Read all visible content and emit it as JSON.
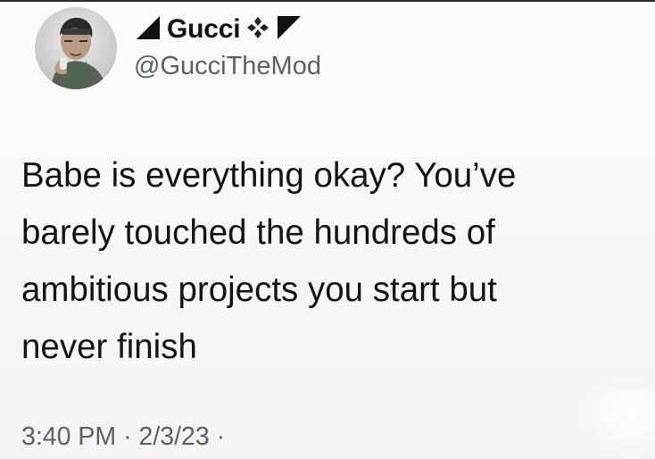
{
  "tweet": {
    "display_name": "Gucci",
    "handle": "@GucciTheMod",
    "text_lines": [
      "Babe is everything okay? You’ve",
      "barely touched the hundreds of",
      "ambitious projects you start but",
      "never finish"
    ],
    "time": "3:40 PM",
    "separator": "·",
    "date": "2/3/23",
    "trailing_separator": "·"
  },
  "icons": {
    "left_flag": "black-triangle-flag-icon",
    "diamond": "four-diamond-icon",
    "right_flag": "black-triangle-flag-icon"
  }
}
